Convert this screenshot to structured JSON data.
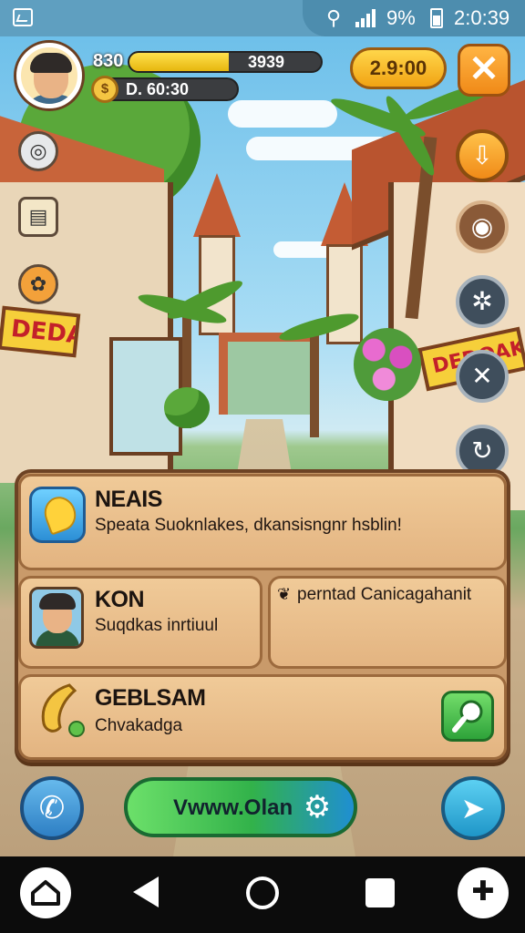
{
  "status_bar": {
    "wifi_icon": "wifi-icon",
    "battery_percent": "9%",
    "time": "2:0:39"
  },
  "hud": {
    "player_level": "830",
    "xp_value": "3939",
    "xp_fraction": 0.52,
    "coins": "D. 60:30",
    "gold_amount": "2.9:00",
    "close_label": "✕"
  },
  "scene": {
    "left_sign": "DEDAA",
    "right_sign": "DEDOAK TA"
  },
  "panel": {
    "row1": {
      "title": "NEAIS",
      "subtitle": "Speata Suoknlakes, dkansisngnr hsblin!"
    },
    "row2": {
      "title": "KON",
      "subtitle": "Suqdkas inrtiuul",
      "right_text": "perntad Canicagahanit"
    },
    "row3": {
      "title": "GEBLSAM",
      "subtitle": "Chvakadga"
    }
  },
  "actions": {
    "main_button_label": "Vwww.Olan"
  },
  "colors": {
    "accent_orange": "#f08a18",
    "gold": "#ffd64a",
    "panel_wood": "#e3b481",
    "main_button_green": "#32b24a"
  }
}
